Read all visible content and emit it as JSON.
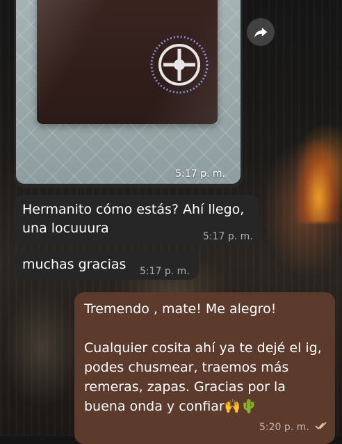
{
  "photo_message": {
    "time": "5:17 p. m."
  },
  "messages": [
    {
      "direction": "incoming",
      "text_lines": [
        "Hermanito cómo estás? Ahí llego,",
        "una locuuura"
      ],
      "time": "5:17 p. m."
    },
    {
      "direction": "incoming",
      "text_lines": [
        "muchas gracias"
      ],
      "time": "5:17 p. m."
    },
    {
      "direction": "outgoing",
      "text_lines": [
        "Tremendo , mate! Me alegro!",
        "",
        "Cualquier cosita ahí ya te dejé el ig,",
        "podes chusmear, traemos más",
        "remeras, zapas. Gracias por la",
        "buena onda y confiar🙌🌵"
      ],
      "time": "5:20 p. m."
    }
  ],
  "icons": {
    "forward": "forward-arrow-icon",
    "read_receipt": "double-check-icon"
  }
}
